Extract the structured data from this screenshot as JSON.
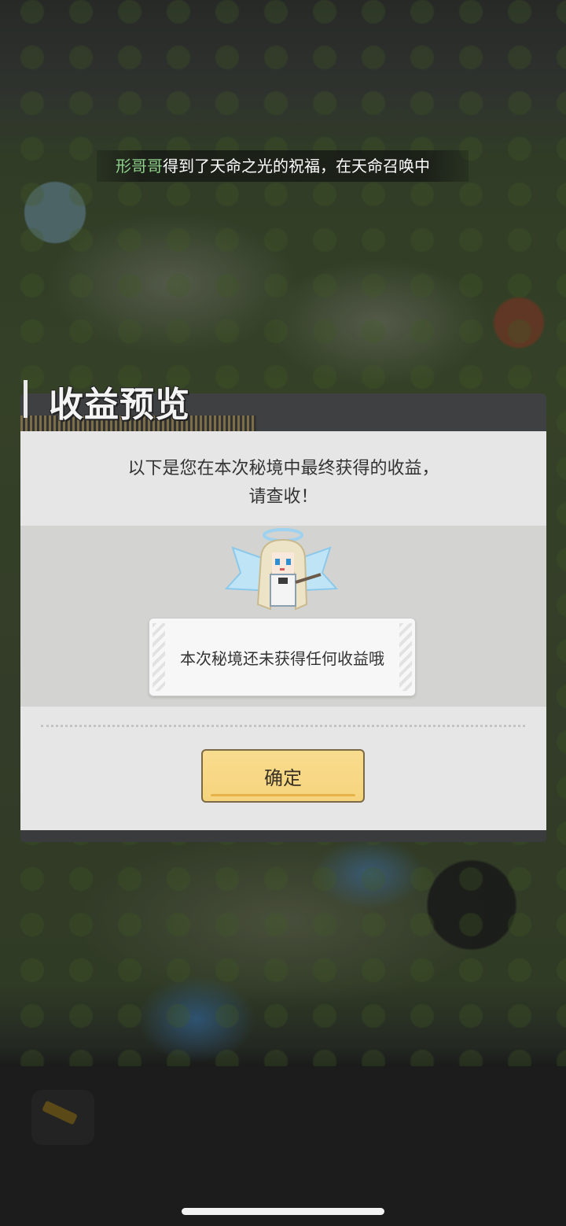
{
  "broadcast": {
    "player_name": "形哥哥",
    "message": "得到了天命之光的祝福，在天命召唤中"
  },
  "dialog": {
    "title": "收益预览",
    "message_line1": "以下是您在本次秘境中最终获得的收益，",
    "message_line2": "请查收！",
    "empty_text": "本次秘境还未获得任何收益哦",
    "confirm_label": "确定"
  },
  "colors": {
    "player_name": "#8fd18a",
    "confirm_button": "#f6d47d",
    "dialog_header": "#3f4042",
    "dialog_body": "#e6e6e6"
  },
  "icons": {
    "mascot": "angel-fairy-mascot",
    "bottom_tool": "brush-icon"
  }
}
